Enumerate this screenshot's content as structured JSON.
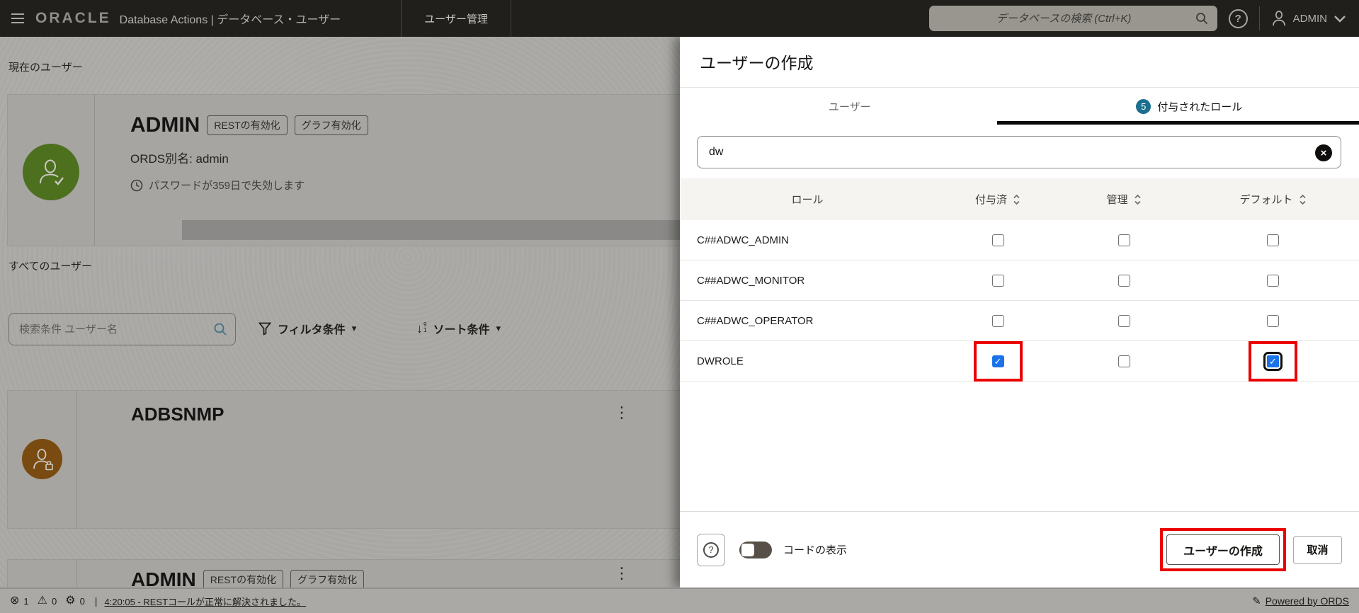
{
  "topbar": {
    "brand": "ORACLE",
    "app": "Database Actions | データベース・ユーザー",
    "tab": "ユーザー管理",
    "search_placeholder": "データベースの検索 (Ctrl+K)",
    "help_glyph": "?",
    "user": "ADMIN"
  },
  "page": {
    "current_user_label": "現在のユーザー",
    "all_users_label": "すべてのユーザー",
    "search_placeholder": "検索条件 ユーザー名",
    "filter_label": "フィルタ条件",
    "sort_label": "ソート条件",
    "current_user": {
      "name": "ADMIN",
      "badges": [
        "RESTの有効化",
        "グラフ有効化"
      ],
      "ords_alias": "ORDS別名: admin",
      "password_note": "パスワードが359日で失効します"
    },
    "user_cards": [
      {
        "name": "ADBSNMP",
        "badges": []
      },
      {
        "name": "ADMIN",
        "badges": [
          "RESTの有効化",
          "グラフ有効化"
        ]
      }
    ]
  },
  "panel": {
    "title": "ユーザーの作成",
    "tabs": [
      {
        "label": "ユーザー",
        "active": false
      },
      {
        "label": "付与されたロール",
        "badge": "5",
        "active": true
      }
    ],
    "search_value": "dw",
    "table": {
      "columns": [
        "ロール",
        "付与済",
        "管理",
        "デフォルト"
      ],
      "rows": [
        {
          "role": "C##ADWC_ADMIN",
          "granted": false,
          "admin": false,
          "default": false
        },
        {
          "role": "C##ADWC_MONITOR",
          "granted": false,
          "admin": false,
          "default": false
        },
        {
          "role": "C##ADWC_OPERATOR",
          "granted": false,
          "admin": false,
          "default": false
        },
        {
          "role": "DWROLE",
          "granted": true,
          "admin": false,
          "default": true,
          "highlight_granted": true,
          "highlight_default": true,
          "default_focused": true
        }
      ]
    },
    "footer": {
      "help_glyph": "?",
      "toggle_label": "コードの表示",
      "create_label": "ユーザーの作成",
      "cancel_label": "取消"
    }
  },
  "statusbar": {
    "errors": "1",
    "warnings": "0",
    "gear_count": "0",
    "separator": "|",
    "message": "4:20:05 - RESTコールが正常に解決されました。",
    "powered": "Powered by ORDS"
  },
  "icons": {
    "error": "⊗",
    "warning": "⚠",
    "gear": "⚙",
    "kebab": "⋮",
    "clear": "×",
    "check": "✓",
    "caret": "▾",
    "pencil": "✎"
  },
  "colors": {
    "annotation_red": "#EB0000",
    "checkbox_blue": "#1A73E8",
    "tab_badge_blue": "#1B6F8F",
    "avatar_green": "#4C701E",
    "avatar_brown": "#7A4B10",
    "topbar_bg": "#211F1C",
    "panel_bg": "#FFFFFF"
  }
}
